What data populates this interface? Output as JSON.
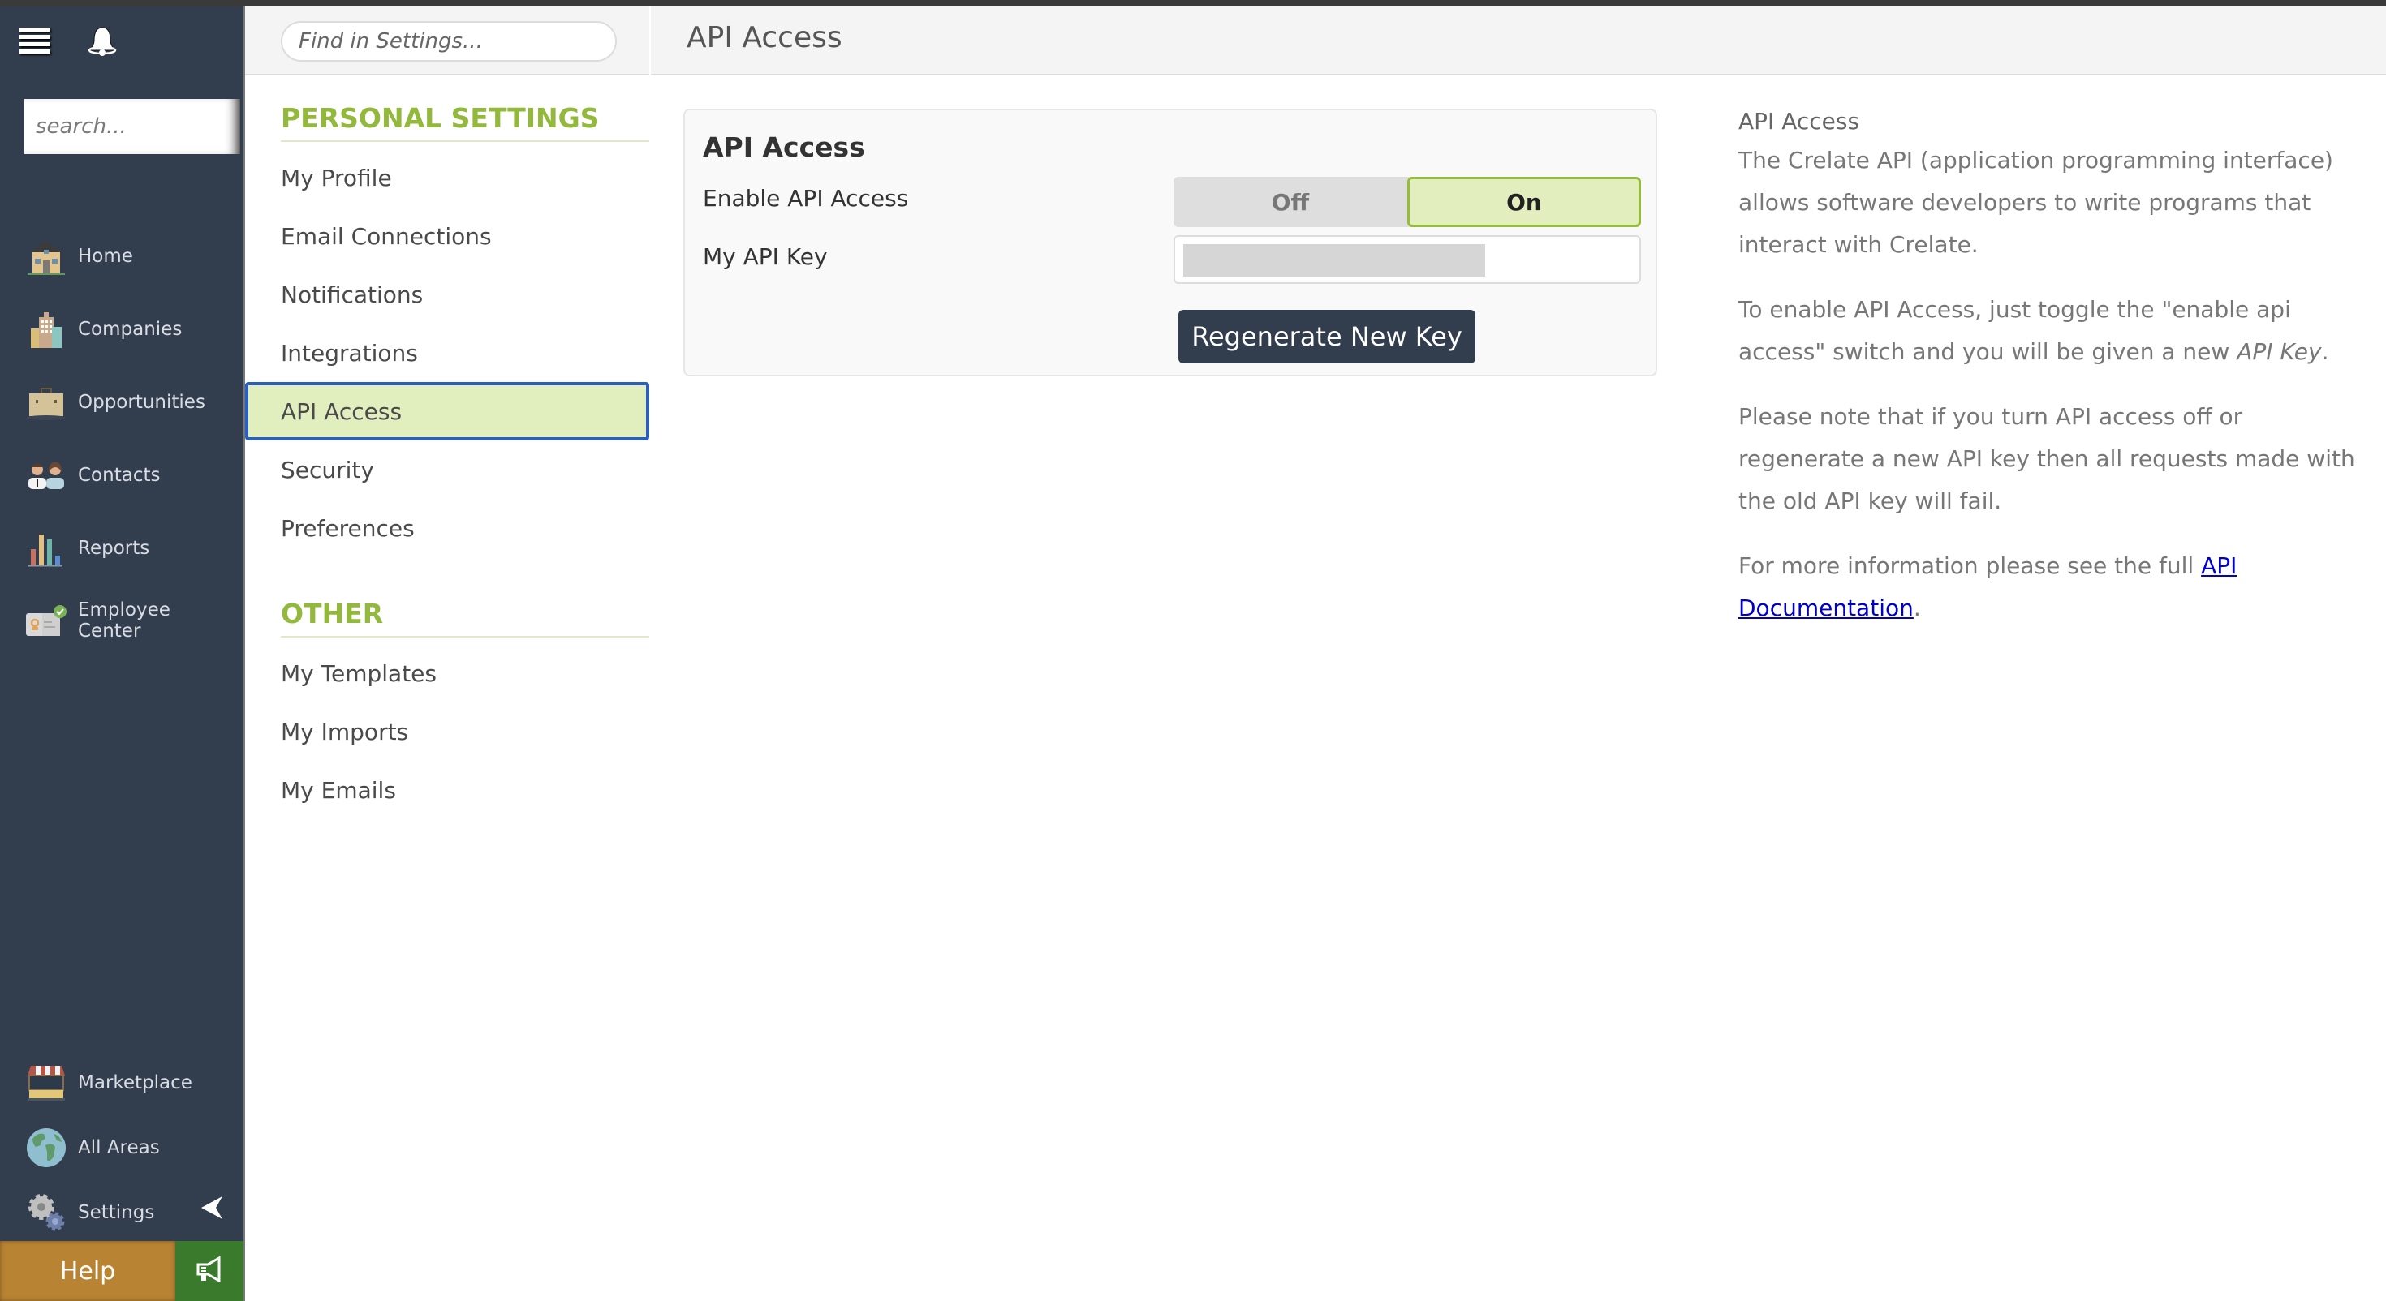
{
  "sidebar": {
    "search_placeholder": "search...",
    "items": [
      {
        "label": "Home",
        "icon": "house-icon"
      },
      {
        "label": "Companies",
        "icon": "buildings-icon"
      },
      {
        "label": "Opportunities",
        "icon": "briefcase-icon"
      },
      {
        "label": "Contacts",
        "icon": "people-icon"
      },
      {
        "label": "Reports",
        "icon": "bar-chart-icon"
      },
      {
        "label": "Employee Center",
        "icon": "id-card-icon"
      }
    ],
    "bottom_items": [
      {
        "label": "Marketplace",
        "icon": "storefront-icon"
      },
      {
        "label": "All Areas",
        "icon": "globe-icon"
      },
      {
        "label": "Settings",
        "icon": "gears-icon"
      }
    ],
    "help_label": "Help",
    "colors": {
      "bg": "#323d4e",
      "help": "#b88332",
      "announce": "#3a7a2c"
    }
  },
  "settings_panel": {
    "search_placeholder": "Find in Settings...",
    "sections": [
      {
        "title": "PERSONAL SETTINGS",
        "items": [
          "My Profile",
          "Email Connections",
          "Notifications",
          "Integrations",
          "API Access",
          "Security",
          "Preferences"
        ]
      },
      {
        "title": "OTHER",
        "items": [
          "My Templates",
          "My Imports",
          "My Emails"
        ]
      }
    ],
    "active_item": "API Access",
    "accent_color": "#92b83c"
  },
  "main": {
    "header_title": "API Access",
    "card": {
      "title": "API Access",
      "enable_label": "Enable API Access",
      "toggle": {
        "off_label": "Off",
        "on_label": "On",
        "value": "On"
      },
      "key_label": "My API Key",
      "key_value": "",
      "regenerate_label": "Regenerate New Key"
    },
    "help": {
      "heading": "API Access",
      "para1": "The Crelate API (application programming interface) allows software developers to write programs that interact with Crelate.",
      "para2_pre": "To enable API Access, just toggle the \"enable api access\" switch and you will be given a new ",
      "para2_em": "API Key",
      "para2_post": ".",
      "para3": "Please note that if you turn API access off or regenerate a new API key then all requests made with the old API key will fail.",
      "para4_pre": "For more information please see the full ",
      "para4_link": "API Documentation",
      "para4_post": "."
    }
  }
}
